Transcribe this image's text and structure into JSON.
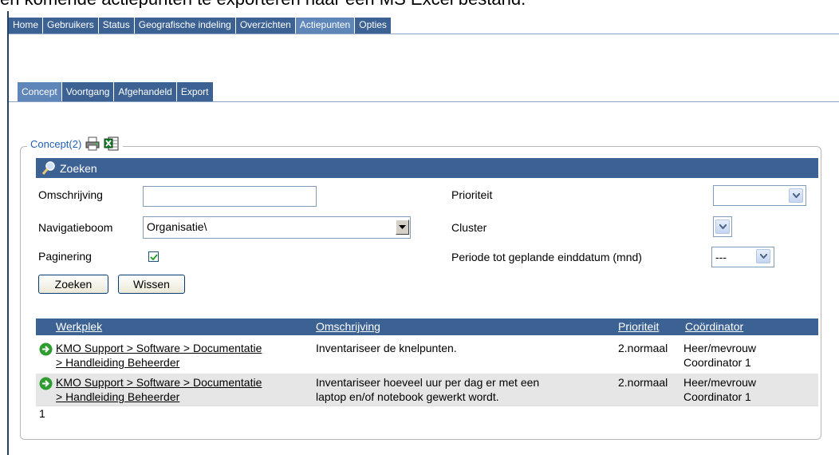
{
  "intro_text": "en komende actiepunten te exporteren naar een MS Excel bestand.",
  "top_menu": {
    "tabs": [
      {
        "label": "Home"
      },
      {
        "label": "Gebruikers"
      },
      {
        "label": "Status"
      },
      {
        "label": "Geografische indeling"
      },
      {
        "label": "Overzichten"
      },
      {
        "label": "Actiepunten",
        "active": true
      },
      {
        "label": "Opties"
      }
    ]
  },
  "sub_tabs": {
    "tabs": [
      {
        "label": "Concept",
        "active": true
      },
      {
        "label": "Voortgang"
      },
      {
        "label": "Afgehandeld"
      },
      {
        "label": "Export"
      }
    ]
  },
  "section": {
    "legend": "Concept(2)",
    "icons": [
      "printer-icon",
      "excel-icon"
    ]
  },
  "search": {
    "title": "Zoeken",
    "omschrijving_label": "Omschrijving",
    "omschrijving_value": "",
    "navigatieboom_label": "Navigatieboom",
    "navigatieboom_value": "Organisatie\\",
    "paginering_label": "Paginering",
    "paginering_checked": true,
    "prioriteit_label": "Prioriteit",
    "prioriteit_value": "",
    "cluster_label": "Cluster",
    "cluster_value": "",
    "periode_label": "Periode tot geplande einddatum (mnd)",
    "periode_value": "---",
    "search_button": "Zoeken",
    "clear_button": "Wissen"
  },
  "results": {
    "columns": [
      "Werkplek",
      "Omschrijving",
      "Prioriteit",
      "Coördinator"
    ],
    "rows": [
      {
        "werkplek_line1": "KMO Support > Software > Documentatie",
        "werkplek_line2": "> Handleiding Beheerder",
        "omschrijving_line1": "Inventariseer de knelpunten.",
        "omschrijving_line2": "",
        "prioriteit": "2.normaal",
        "coordinator_line1": "Heer/mevrouw",
        "coordinator_line2": "Coordinator 1"
      },
      {
        "werkplek_line1": "KMO Support > Software > Documentatie",
        "werkplek_line2": "> Handleiding Beheerder",
        "omschrijving_line1": "Inventariseer hoeveel uur per dag er met een",
        "omschrijving_line2": "laptop en/of notebook gewerkt wordt.",
        "prioriteit": "2.normaal",
        "coordinator_line1": "Heer/mevrouw",
        "coordinator_line2": "Coordinator 1"
      }
    ],
    "pager": "1"
  },
  "colors": {
    "menu_bg": "#3c6294",
    "menu_active": "#5f86b8",
    "row_alt": "#e6e6e6",
    "legend_text": "#1f5fb4"
  }
}
